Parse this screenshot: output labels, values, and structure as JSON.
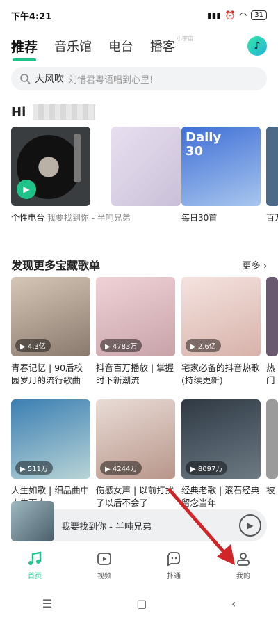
{
  "status": {
    "time": "下午4:21",
    "battery": "31"
  },
  "tabs": [
    "推荐",
    "音乐馆",
    "电台",
    "播客"
  ],
  "corner_tag": "小宇宙",
  "search": {
    "keyword": "大风吹",
    "hint": "刘惜君粤语唱到心里!"
  },
  "greeting": "Hi",
  "top_cards": [
    {
      "label": "个性电台",
      "sub": "我要找到你 - 半吨兄弟"
    },
    {
      "label": "",
      "sub": ""
    },
    {
      "label": "每日30首",
      "sub": ""
    },
    {
      "label": "百万",
      "sub": ""
    }
  ],
  "daily_cover": {
    "line1": "Daily",
    "line2": "30"
  },
  "section": {
    "title": "发现更多宝藏歌单",
    "more": "更多"
  },
  "playlists": [
    {
      "name": "青春记忆 | 90后校园岁月的流行歌曲",
      "plays": "4.3亿"
    },
    {
      "name": "抖音百万播放 | 掌握时下新潮流",
      "plays": "4783万"
    },
    {
      "name": "宅家必备的抖音热歌 (持续更新)",
      "plays": "2.6亿"
    },
    {
      "name": "热门",
      "plays": ""
    },
    {
      "name": "人生如歌 | 细品曲中人生百态",
      "plays": "511万"
    },
    {
      "name": "伤感女声 | 以前打扰了以后不会了",
      "plays": "4244万"
    },
    {
      "name": "经典老歌 | 滚石经典留念当年",
      "plays": "8097万"
    },
    {
      "name": "被",
      "plays": ""
    }
  ],
  "mini_player": {
    "title": "我要找到你 - 半吨兄弟"
  },
  "bottom_nav": [
    "首页",
    "视频",
    "扑通",
    "我的"
  ],
  "colors": {
    "accent": "#1ec38a",
    "annotation_arrow": "#d0262a"
  }
}
